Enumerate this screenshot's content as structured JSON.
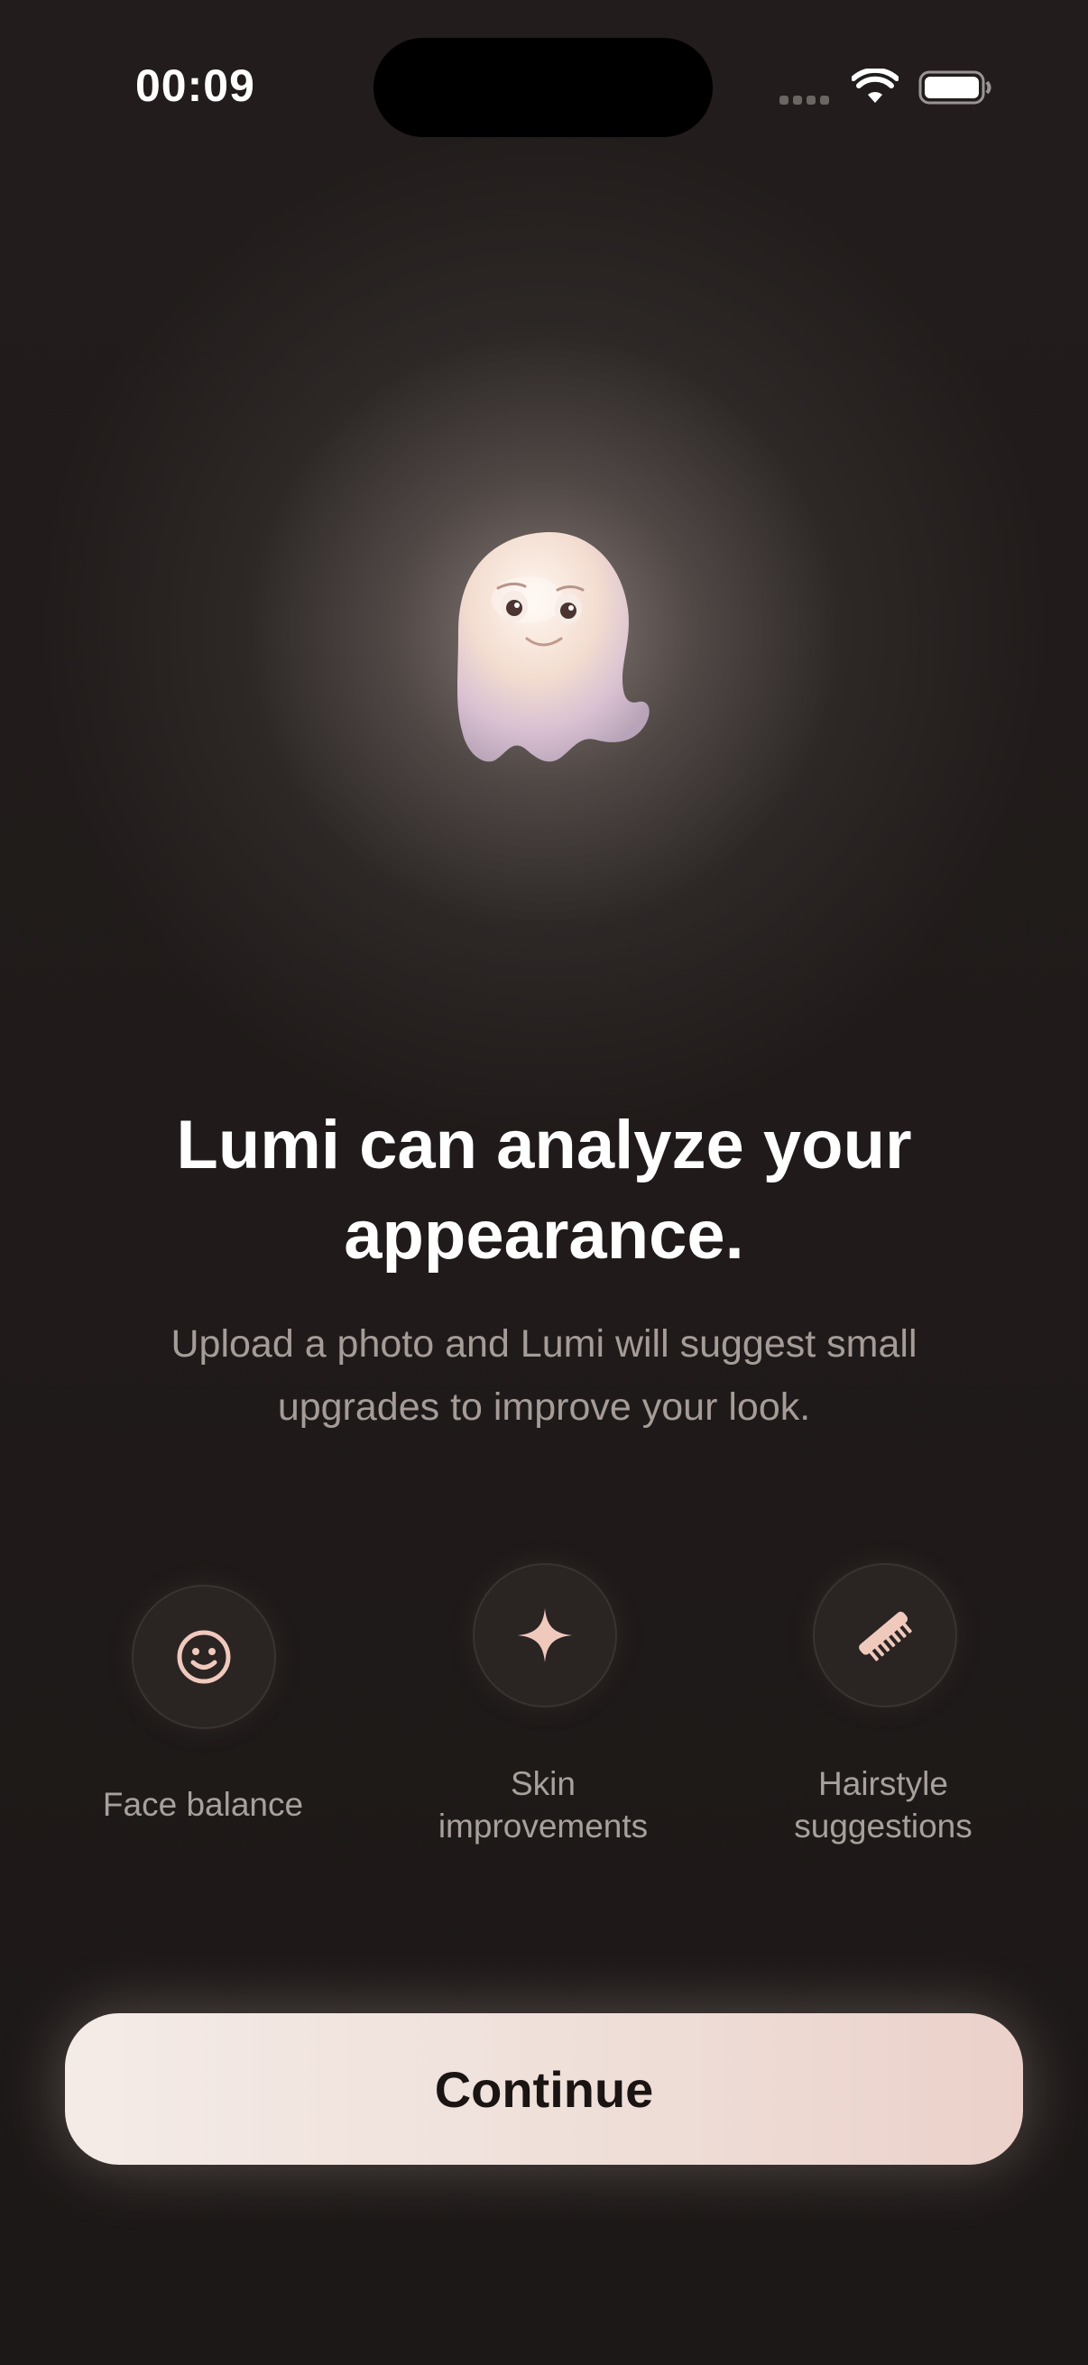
{
  "status_bar": {
    "time": "00:09",
    "icons": [
      "cellular-signal-icon",
      "wifi-icon",
      "battery-icon"
    ]
  },
  "mascot": {
    "name": "ghost-mascot",
    "description_icon": "ghost-icon"
  },
  "headline": {
    "line1": "Lumi can analyze your",
    "line2": "appearance."
  },
  "subtitle": {
    "line1": "Upload a photo and Lumi will suggest small",
    "line2": "upgrades to improve your look."
  },
  "features": [
    {
      "icon": "smiley-face-icon",
      "label_line1": "Face balance",
      "label_line2": ""
    },
    {
      "icon": "sparkle-icon",
      "label_line1": "Skin",
      "label_line2": "improvements"
    },
    {
      "icon": "comb-icon",
      "label_line1": "Hairstyle",
      "label_line2": "suggestions"
    }
  ],
  "continue_button": {
    "label": "Continue"
  },
  "colors": {
    "background": "#1c1817",
    "accent_icon": "#f0c9bd",
    "button_start": "#f4ebe7",
    "button_end": "#ebd1ca",
    "subtitle_text": "#a59c98"
  }
}
